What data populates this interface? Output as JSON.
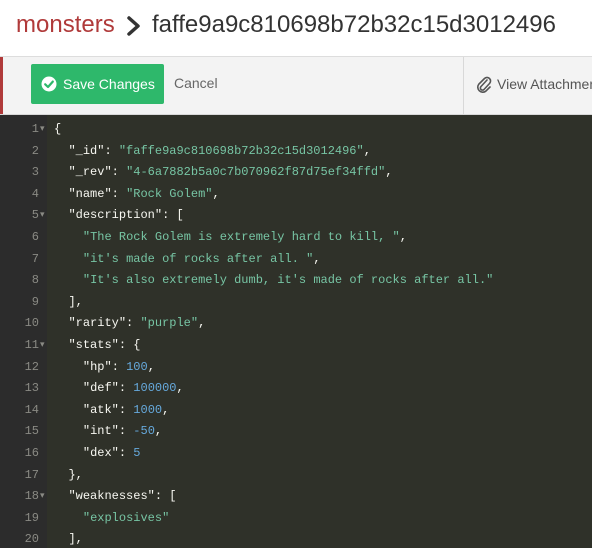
{
  "breadcrumb": {
    "database": "monsters",
    "document_id": "faffe9a9c810698b72b32c15d3012496"
  },
  "toolbar": {
    "save_label": "Save Changes",
    "cancel_label": "Cancel",
    "attach_label": "View Attachments"
  },
  "colors": {
    "save_button": "#2eb86b",
    "database_link": "#b03a3a",
    "editor_bg": "#2f3129",
    "string": "#77c5a4",
    "number": "#66a9dc"
  },
  "editor": {
    "lines": [
      {
        "num": "1",
        "fold": "▾",
        "text": "{"
      },
      {
        "num": "2",
        "fold": "",
        "key": "\"_id\"",
        "sep": ": ",
        "value": "\"faffe9a9c810698b72b32c15d3012496\"",
        "vtype": "s",
        "tail": ","
      },
      {
        "num": "3",
        "fold": "",
        "key": "\"_rev\"",
        "sep": ": ",
        "value": "\"4-6a7882b5a0c7b070962f87d75ef34ffd\"",
        "vtype": "s",
        "tail": ","
      },
      {
        "num": "4",
        "fold": "",
        "key": "\"name\"",
        "sep": ": ",
        "value": "\"Rock Golem\"",
        "vtype": "s",
        "tail": ","
      },
      {
        "num": "5",
        "fold": "▾",
        "key": "\"description\"",
        "sep": ": ",
        "value": "",
        "vtype": "p",
        "tail": "["
      },
      {
        "num": "6",
        "fold": "",
        "value": "\"The Rock Golem is extremely hard to kill, \"",
        "vtype": "s",
        "tail": ",",
        "indent": 2
      },
      {
        "num": "7",
        "fold": "",
        "value": "\"it's made of rocks after all. \"",
        "vtype": "s",
        "tail": ",",
        "indent": 2
      },
      {
        "num": "8",
        "fold": "",
        "value": "\"It's also extremely dumb, it's made of rocks after all.\"",
        "vtype": "s",
        "tail": "",
        "indent": 2
      },
      {
        "num": "9",
        "fold": "",
        "text": "],",
        "indent": 1
      },
      {
        "num": "10",
        "fold": "",
        "key": "\"rarity\"",
        "sep": ": ",
        "value": "\"purple\"",
        "vtype": "s",
        "tail": ","
      },
      {
        "num": "11",
        "fold": "▾",
        "key": "\"stats\"",
        "sep": ": ",
        "value": "",
        "vtype": "p",
        "tail": "{"
      },
      {
        "num": "12",
        "fold": "",
        "key": "\"hp\"",
        "sep": ": ",
        "value": "100",
        "vtype": "n",
        "tail": ",",
        "indent": 2
      },
      {
        "num": "13",
        "fold": "",
        "key": "\"def\"",
        "sep": ": ",
        "value": "100000",
        "vtype": "n",
        "tail": ",",
        "indent": 2
      },
      {
        "num": "14",
        "fold": "",
        "key": "\"atk\"",
        "sep": ": ",
        "value": "1000",
        "vtype": "n",
        "tail": ",",
        "indent": 2
      },
      {
        "num": "15",
        "fold": "",
        "key": "\"int\"",
        "sep": ": ",
        "value": "-50",
        "vtype": "n",
        "tail": ",",
        "indent": 2
      },
      {
        "num": "16",
        "fold": "",
        "key": "\"dex\"",
        "sep": ": ",
        "value": "5",
        "vtype": "n",
        "tail": "",
        "indent": 2
      },
      {
        "num": "17",
        "fold": "",
        "text": "},",
        "indent": 1
      },
      {
        "num": "18",
        "fold": "▾",
        "key": "\"weaknesses\"",
        "sep": ": ",
        "value": "",
        "vtype": "p",
        "tail": "["
      },
      {
        "num": "19",
        "fold": "",
        "value": "\"explosives\"",
        "vtype": "s",
        "tail": "",
        "indent": 2
      },
      {
        "num": "20",
        "fold": "",
        "text": "],",
        "indent": 1
      }
    ]
  }
}
